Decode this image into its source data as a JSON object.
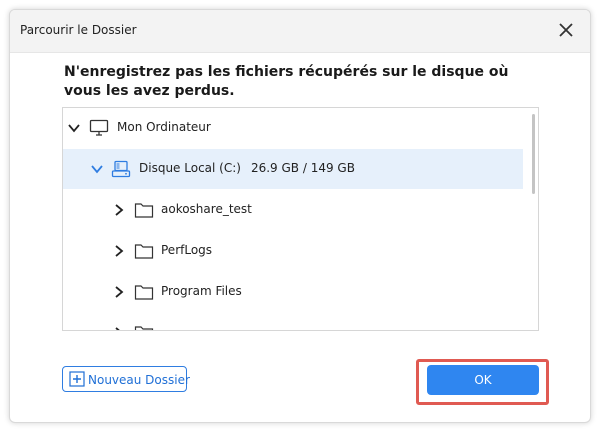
{
  "dialog": {
    "title": "Parcourir le Dossier",
    "heading": "N'enregistrez pas les fichiers récupérés sur le disque où vous les avez perdus."
  },
  "tree": {
    "computer": {
      "label": "Mon Ordinateur",
      "icon": "monitor-icon",
      "expanded": true
    },
    "drive": {
      "label": "Disque Local (C:)",
      "size": "26.9 GB / 149 GB",
      "icon": "drive-icon",
      "expanded": true,
      "selected": true
    },
    "folders": [
      {
        "label": "aokoshare_test",
        "icon": "folder-icon"
      },
      {
        "label": "PerfLogs",
        "icon": "folder-icon"
      },
      {
        "label": "Program Files",
        "icon": "folder-icon"
      }
    ]
  },
  "buttons": {
    "new_folder": "Nouveau Dossier",
    "ok": "OK"
  },
  "colors": {
    "accent": "#2f86f0",
    "selected_row": "#e6f0fb",
    "highlight": "#e05a52"
  }
}
